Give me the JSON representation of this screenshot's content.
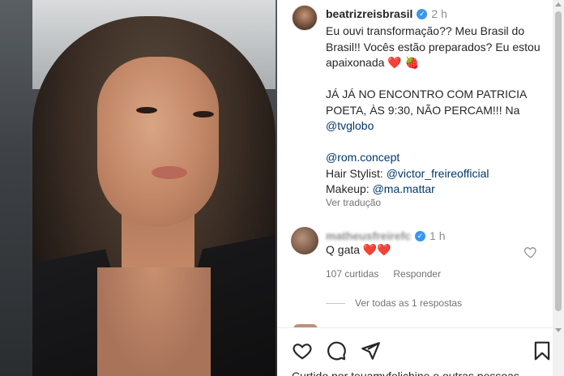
{
  "post": {
    "author": "beatrizreisbrasil",
    "time": "2 h",
    "caption": {
      "p1_text": "Eu ouvi transformação?? Meu Brasil do Brasil!! Vocês estão preparados? Eu estou apaixonada",
      "p1_emoji_heart": "❤️",
      "p1_emoji_berry": "🍓",
      "p2_text": "JÁ JÁ NO ENCONTRO COM PATRICIA POETA, ÀS 9:30, NÃO PERCAM!!! Na",
      "p2_link": "@tvglobo",
      "p3_link": "@rom.concept",
      "p4_label": "Hair Stylist: ",
      "p4_link": "@victor_freireofficial",
      "p5_label": "Makeup: ",
      "p5_link": "@ma.mattar"
    },
    "translate_label": "Ver tradução"
  },
  "comment": {
    "username": "matheusfreirefc",
    "time": "1 h",
    "text": "Q gata",
    "emoji": "❤️❤️",
    "likes": "107 curtidas",
    "reply_label": "Responder",
    "view_replies": "Ver todas as 1 respostas"
  },
  "footer": {
    "liked_by": "Curtido por teuamyfelichine e outras pessoas"
  },
  "icons": {
    "like": "heart-outline-icon",
    "comment": "speech-bubble-icon",
    "share": "paper-plane-icon",
    "save": "bookmark-icon",
    "verified": "verified-badge-icon"
  },
  "colors": {
    "link": "#00376b",
    "verified": "#3897f0",
    "heart": "#ed4956",
    "secondary_text": "#737373"
  }
}
